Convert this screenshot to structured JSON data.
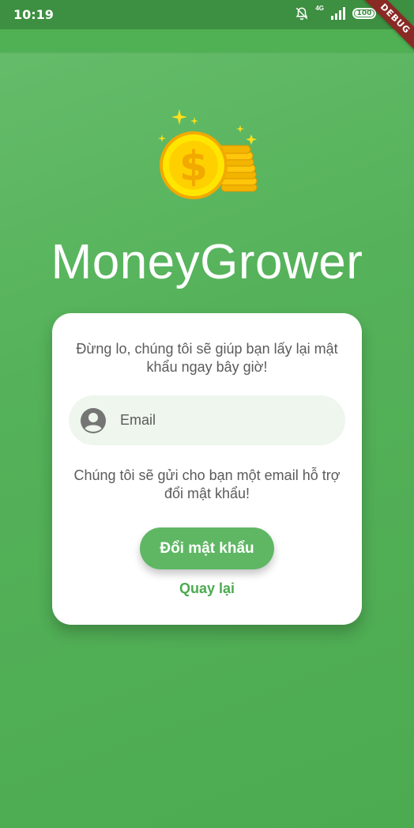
{
  "status_bar": {
    "time": "10:19",
    "network": "4G",
    "battery": "100",
    "icons": [
      "bell-off-icon",
      "signal-icon",
      "battery-icon",
      "charging-bolt-icon"
    ]
  },
  "debug_ribbon": "DEBUG",
  "app": {
    "title": "MoneyGrower",
    "logo_icon": "gold-coins-icon"
  },
  "card": {
    "description": "Đừng lo, chúng tôi sẽ giúp bạn lấy lại mật khẩu ngay bây giờ!",
    "email": {
      "placeholder": "Email",
      "value": "",
      "icon": "user-account-icon"
    },
    "note": "Chúng tôi sẽ gửi cho bạn một email hỗ trợ đổi mật khẩu!",
    "submit_label": "Đổi mật khẩu",
    "back_label": "Quay lại"
  },
  "colors": {
    "background": "#55b25a",
    "status_bar": "#3d8f41",
    "app_bar": "#4fb054",
    "button": "#5fb764",
    "link": "#4caa50",
    "input_bg": "#eef6ee",
    "text": "#5b5b5b"
  }
}
